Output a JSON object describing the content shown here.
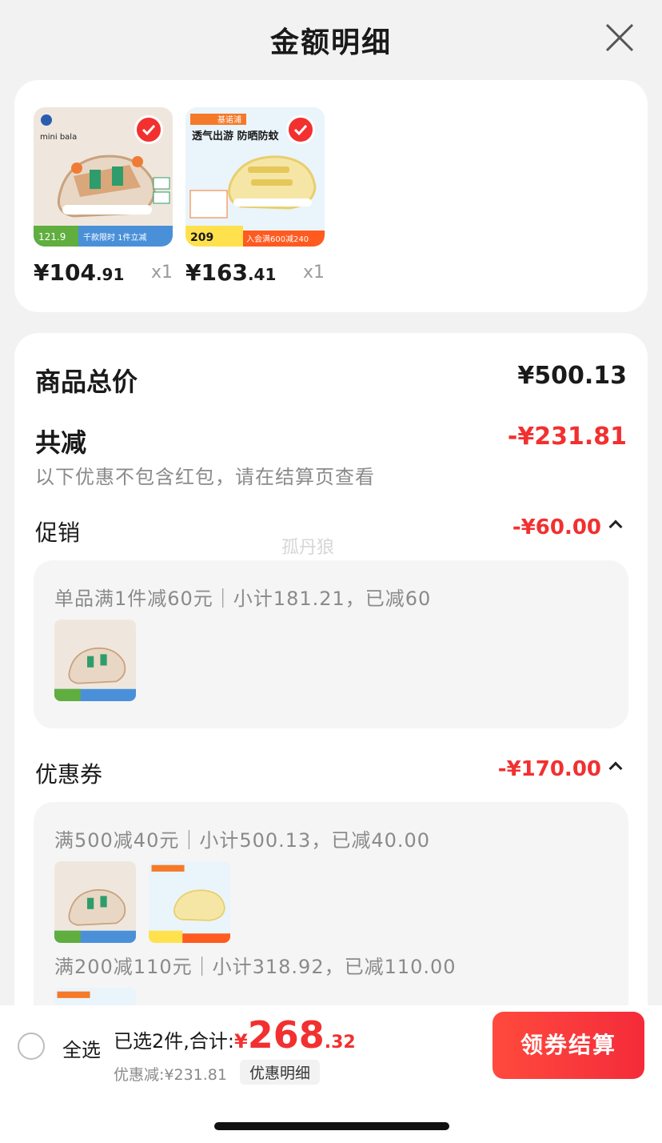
{
  "header": {
    "title": "金额明细",
    "close_icon": "close-icon"
  },
  "products": [
    {
      "brand": "mini bala",
      "badge_price": "121.9",
      "banner": "千款限时 1件立减",
      "price_int": "¥104",
      "price_dec": ".91",
      "qty": "x1",
      "selected": true
    },
    {
      "brand": "基诺浦",
      "headline": "透气出游 防晒防蚊",
      "badge_price": "209",
      "banner": "入会满600减240",
      "price_int": "¥163",
      "price_dec": ".41",
      "qty": "x1",
      "selected": true
    }
  ],
  "summary": {
    "total_label": "商品总价",
    "total_value": "¥500.13",
    "discount_label": "共减",
    "discount_value": "-¥231.81",
    "note": "以下优惠不包含红包，请在结算页查看"
  },
  "promotion": {
    "label": "促销",
    "value": "-¥60.00",
    "rule": "单品满1件减60元｜小计181.21，已减60"
  },
  "coupon": {
    "label": "优惠券",
    "value": "-¥170.00",
    "rule1": "满500减40元｜小计500.13，已减40.00",
    "rule2": "满200减110元｜小计318.92，已减110.00"
  },
  "watermark": "孤丹狼",
  "bottom_bar": {
    "select_all": "全选",
    "selected_count": "已选2件,合计:",
    "currency": "¥",
    "total_int": "268",
    "total_dec": ".32",
    "discount_text": "优惠减:¥231.81",
    "discount_detail_button": "优惠明细",
    "checkout_button": "领券结算"
  },
  "colors": {
    "accent": "#f23030",
    "background": "#f2f2f2"
  }
}
